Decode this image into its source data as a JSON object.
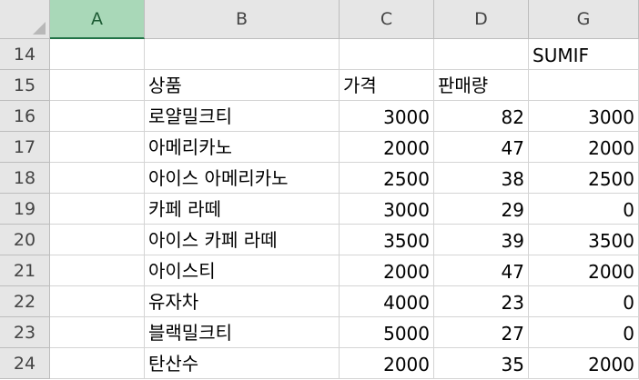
{
  "columns": [
    "A",
    "B",
    "C",
    "D",
    "G"
  ],
  "selected_column": "A",
  "rows": [
    {
      "row": "14",
      "a": "",
      "b": "",
      "c": "",
      "d": "",
      "g": "SUMIF"
    },
    {
      "row": "15",
      "a": "",
      "b": "상품",
      "c": "가격",
      "d": "판매량",
      "g": ""
    },
    {
      "row": "16",
      "a": "",
      "b": "로얄밀크티",
      "c": "3000",
      "d": "82",
      "g": "3000"
    },
    {
      "row": "17",
      "a": "",
      "b": "아메리카노",
      "c": "2000",
      "d": "47",
      "g": "2000"
    },
    {
      "row": "18",
      "a": "",
      "b": "아이스 아메리카노",
      "c": "2500",
      "d": "38",
      "g": "2500"
    },
    {
      "row": "19",
      "a": "",
      "b": "카페 라떼",
      "c": "3000",
      "d": "29",
      "g": "0"
    },
    {
      "row": "20",
      "a": "",
      "b": "아이스 카페 라떼",
      "c": "3500",
      "d": "39",
      "g": "3500"
    },
    {
      "row": "21",
      "a": "",
      "b": "아이스티",
      "c": "2000",
      "d": "47",
      "g": "2000"
    },
    {
      "row": "22",
      "a": "",
      "b": "유자차",
      "c": "4000",
      "d": "23",
      "g": "0"
    },
    {
      "row": "23",
      "a": "",
      "b": "블랙밀크티",
      "c": "5000",
      "d": "27",
      "g": "0"
    },
    {
      "row": "24",
      "a": "",
      "b": "탄산수",
      "c": "2000",
      "d": "35",
      "g": "2000"
    }
  ],
  "colors": {
    "header_bg": "#e6e6e6",
    "selected_header_bg": "#a9d8b8",
    "selected_header_border": "#217346",
    "gridline": "#d4d4d4"
  }
}
